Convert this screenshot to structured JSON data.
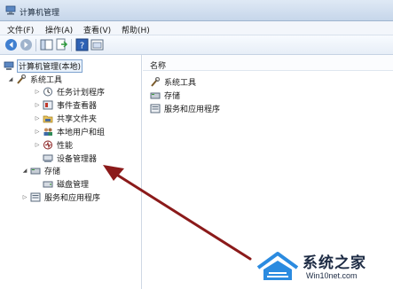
{
  "window": {
    "title": "计算机管理"
  },
  "menu": [
    "文件(F)",
    "操作(A)",
    "查看(V)",
    "帮助(H)"
  ],
  "toolbar": {
    "buttons": [
      "back-icon",
      "forward-icon",
      "console-tree-icon",
      "export-icon",
      "help-icon",
      "properties-icon"
    ]
  },
  "tree": {
    "root": "计算机管理(本地)",
    "system_tools": "系统工具",
    "task_scheduler": "任务计划程序",
    "event_viewer": "事件查看器",
    "shared_folders": "共享文件夹",
    "local_users": "本地用户和组",
    "performance": "性能",
    "device_manager": "设备管理器",
    "storage": "存储",
    "disk_management": "磁盘管理",
    "services_apps": "服务和应用程序"
  },
  "list": {
    "header": "名称",
    "items": [
      "系统工具",
      "存储",
      "服务和应用程序"
    ]
  },
  "watermark": {
    "main": "系统之家",
    "sub": "Win10net.com"
  },
  "colors": {
    "arrow": "#8b1a1a",
    "selection": "#eaf2fb",
    "title_bar": "#c6d6ea"
  }
}
